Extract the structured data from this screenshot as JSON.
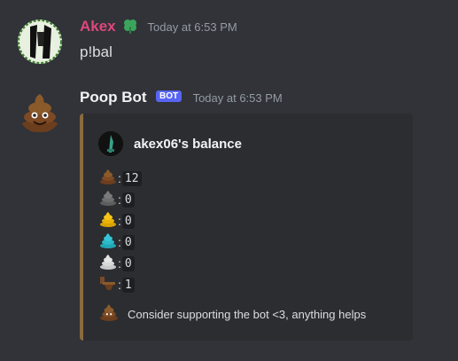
{
  "messages": [
    {
      "username": "Akex",
      "username_color": "#e0467a",
      "badge_icon": "clover-icon",
      "timestamp": "Today at 6:53 PM",
      "content": "p!bal"
    },
    {
      "username": "Poop Bot",
      "username_color": "#f2f3f5",
      "bot_tag": "BOT",
      "timestamp": "Today at 6:53 PM",
      "embed": {
        "author": "akex06's balance",
        "accent_color": "#8a6a3e",
        "balances": [
          {
            "icon": "brown-poop-icon",
            "color": "#8b5a2b",
            "value": "12"
          },
          {
            "icon": "gray-poop-icon",
            "color": "#7a7a7a",
            "value": "0"
          },
          {
            "icon": "gold-poop-icon",
            "color": "#f5c518",
            "value": "0"
          },
          {
            "icon": "cyan-poop-icon",
            "color": "#35c6d6",
            "value": "0"
          },
          {
            "icon": "white-poop-icon",
            "color": "#e6e6e6",
            "value": "0"
          },
          {
            "icon": "toilet-icon",
            "color": "#7a4a28",
            "value": "1"
          }
        ],
        "footer": "Consider supporting the bot <3, anything helps"
      }
    }
  ]
}
